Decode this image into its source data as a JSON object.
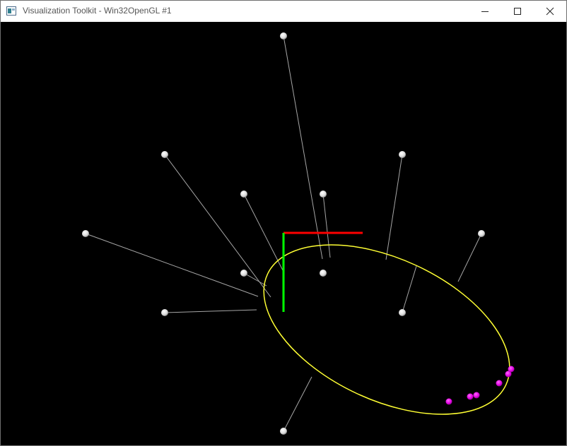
{
  "window": {
    "title": "Visualization Toolkit - Win32OpenGL #1",
    "icon": "vtk-window-icon",
    "controls": [
      "minimize-icon",
      "maximize-icon",
      "close-icon"
    ]
  },
  "scene": {
    "background": "#000000",
    "colors": {
      "spheres": "#ffffff",
      "connectors": "#a6a6a6",
      "ellipse": "#ffff33",
      "x_axis": "#ff0000",
      "y_axis": "#00ff00",
      "markers": "#ff00ff"
    }
  }
}
